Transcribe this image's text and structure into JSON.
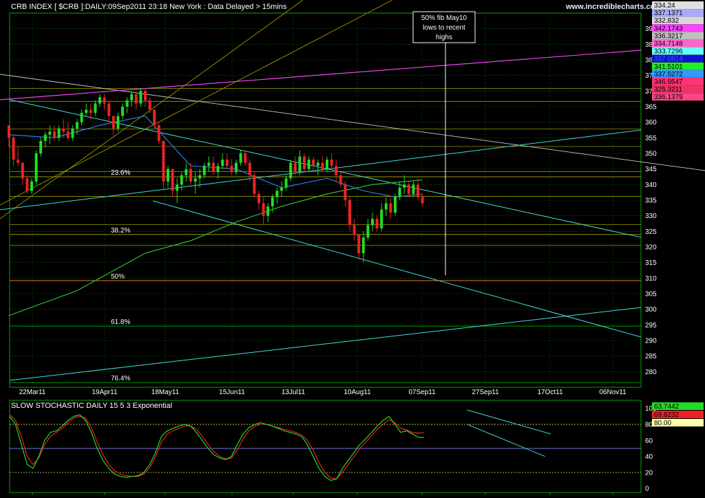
{
  "header": {
    "title": "CRB INDEX [ $CRB ]:DAILY:09Sep2011 23:18 New York  : Data Delayed > 15mins",
    "brand": "www.incrediblecharts.com"
  },
  "colors": {
    "background": "#000000",
    "grid": "#00aa00",
    "up": "#22dd22",
    "down": "#ee2222",
    "ma_short": "#3388ff",
    "ma_long": "#33cc33",
    "fib_line": "#999900",
    "fib_50": "#ff8833",
    "trend_cyan": "#44dddd",
    "trend_magenta": "#ee44ee",
    "trend_white": "#cccccc",
    "trend_olive": "#999900",
    "stoch_k": "#22dd22",
    "stoch_d": "#ee2222"
  },
  "chart_data": [
    {
      "type": "candlestick",
      "title": "CRB INDEX [ $CRB ]:DAILY:09Sep2011 23:18 New York  : Data Delayed > 15mins",
      "x_tick_labels": [
        "22Mar11",
        "19Apr11",
        "18May11",
        "15Jun11",
        "13Jul11",
        "10Aug11",
        "07Sep11",
        "27Sep11",
        "17Oct11",
        "06Nov11"
      ],
      "y_tick_labels": [
        "280",
        "285",
        "290",
        "295",
        "300",
        "305",
        "310",
        "315",
        "320",
        "325",
        "330",
        "335",
        "340",
        "345",
        "350",
        "355",
        "360",
        "365",
        "370",
        "375",
        "380",
        "385",
        "390"
      ],
      "ylim": [
        275,
        395
      ],
      "grid": true,
      "fib_levels": [
        {
          "label": "23.6%",
          "value": 342.5
        },
        {
          "label": "38.2%",
          "value": 324
        },
        {
          "label": "50%",
          "value": 309.2
        },
        {
          "label": "61.8%",
          "value": 294.6
        },
        {
          "label": "76.4%",
          "value": 276.5
        }
      ],
      "extra_levels": [
        370.8,
        366.7,
        357.8,
        352.2,
        344.2,
        336.2,
        327.2,
        320.5
      ],
      "annotation": {
        "lines": [
          "50% fib May10",
          "lows to recent",
          "highs"
        ]
      },
      "value_badges": [
        {
          "label": "334.24",
          "bg": "#e0e0e0",
          "fg": "#000000"
        },
        {
          "label": "337.1371",
          "bg": "#aaaaff",
          "fg": "#000000"
        },
        {
          "label": "332.832",
          "bg": "#d8d8d8",
          "fg": "#000000"
        },
        {
          "label": "342.1743",
          "bg": "#ff44ff",
          "fg": "#000000"
        },
        {
          "label": "336.3217",
          "bg": "#c0c0c0",
          "fg": "#000000"
        },
        {
          "label": "334.7148",
          "bg": "#ff66cc",
          "fg": "#000000"
        },
        {
          "label": "333.7296",
          "bg": "#66ffff",
          "fg": "#000000"
        },
        {
          "label": "337.0814",
          "bg": "#1111cc",
          "fg": "#4455ff"
        },
        {
          "label": "341.5101",
          "bg": "#22ee22",
          "fg": "#000000"
        },
        {
          "label": "337.5272",
          "bg": "#3399ff",
          "fg": "#000000"
        },
        {
          "label": "346.9547",
          "bg": "#ff3377",
          "fg": "#000000"
        },
        {
          "label": "325.3211",
          "bg": "#ee3366",
          "fg": "#000000"
        },
        {
          "label": "336.1379",
          "bg": "#ff4488",
          "fg": "#000000"
        }
      ],
      "candles": [
        [
          0,
          359,
          358,
          352,
          355
        ],
        [
          1,
          355,
          356,
          346,
          348
        ],
        [
          2,
          348,
          352,
          346,
          347
        ],
        [
          3,
          347,
          347,
          340,
          342
        ],
        [
          4,
          342,
          343,
          337,
          338
        ],
        [
          5,
          338,
          342,
          337,
          341
        ],
        [
          6,
          341,
          351,
          340,
          350
        ],
        [
          7,
          350,
          355,
          349,
          354
        ],
        [
          8,
          354,
          357,
          352,
          356
        ],
        [
          9,
          356,
          359,
          353,
          357
        ],
        [
          10,
          357,
          359,
          354,
          355
        ],
        [
          11,
          355,
          359,
          354,
          358
        ],
        [
          12,
          358,
          361,
          355,
          357
        ],
        [
          13,
          357,
          360,
          354,
          355
        ],
        [
          14,
          355,
          359,
          354,
          358
        ],
        [
          15,
          358,
          361,
          356,
          360
        ],
        [
          16,
          360,
          364,
          359,
          363
        ],
        [
          17,
          363,
          366,
          362,
          364
        ],
        [
          18,
          364,
          366,
          361,
          363
        ],
        [
          19,
          363,
          367,
          362,
          366
        ],
        [
          20,
          366,
          369,
          365,
          368
        ],
        [
          21,
          368,
          369,
          364,
          366
        ],
        [
          22,
          366,
          367,
          360,
          362
        ],
        [
          23,
          362,
          362,
          356,
          358
        ],
        [
          24,
          358,
          363,
          357,
          362
        ],
        [
          25,
          362,
          366,
          361,
          365
        ],
        [
          26,
          365,
          368,
          363,
          367
        ],
        [
          27,
          367,
          370,
          365,
          369
        ],
        [
          28,
          369,
          369,
          364,
          366
        ],
        [
          29,
          366,
          371,
          365,
          370
        ],
        [
          30,
          370,
          371,
          365,
          367
        ],
        [
          31,
          367,
          368,
          363,
          364
        ],
        [
          32,
          364,
          364,
          358,
          359
        ],
        [
          33,
          359,
          360,
          353,
          354
        ],
        [
          34,
          354,
          354,
          338,
          341
        ],
        [
          35,
          341,
          346,
          339,
          345
        ],
        [
          36,
          345,
          345,
          336,
          338
        ],
        [
          37,
          338,
          342,
          334,
          340
        ],
        [
          38,
          340,
          344,
          338,
          343
        ],
        [
          39,
          343,
          347,
          341,
          345
        ],
        [
          40,
          345,
          347,
          340,
          341
        ],
        [
          41,
          341,
          344,
          337,
          342
        ],
        [
          42,
          342,
          345,
          339,
          343
        ],
        [
          43,
          343,
          347,
          342,
          346
        ],
        [
          44,
          346,
          349,
          344,
          347
        ],
        [
          45,
          347,
          349,
          343,
          344
        ],
        [
          46,
          344,
          347,
          342,
          346
        ],
        [
          47,
          346,
          350,
          345,
          348
        ],
        [
          48,
          348,
          350,
          345,
          346
        ],
        [
          49,
          346,
          348,
          343,
          344
        ],
        [
          50,
          344,
          348,
          343,
          347
        ],
        [
          51,
          347,
          351,
          346,
          350
        ],
        [
          52,
          350,
          351,
          346,
          347
        ],
        [
          53,
          347,
          348,
          341,
          343
        ],
        [
          54,
          343,
          344,
          336,
          337
        ],
        [
          55,
          337,
          338,
          332,
          334
        ],
        [
          56,
          334,
          336,
          327,
          330
        ],
        [
          57,
          330,
          334,
          328,
          333
        ],
        [
          58,
          333,
          337,
          331,
          336
        ],
        [
          59,
          336,
          339,
          334,
          338
        ],
        [
          60,
          338,
          341,
          336,
          339
        ],
        [
          61,
          339,
          343,
          338,
          342
        ],
        [
          62,
          342,
          348,
          341,
          347
        ],
        [
          63,
          347,
          349,
          343,
          344
        ],
        [
          64,
          344,
          351,
          343,
          349
        ],
        [
          65,
          349,
          350,
          344,
          345
        ],
        [
          66,
          345,
          349,
          344,
          348
        ],
        [
          67,
          348,
          349,
          344,
          346
        ],
        [
          68,
          346,
          348,
          343,
          347
        ],
        [
          69,
          347,
          349,
          344,
          345
        ],
        [
          70,
          345,
          349,
          344,
          348
        ],
        [
          71,
          348,
          350,
          345,
          346
        ],
        [
          72,
          346,
          348,
          341,
          343
        ],
        [
          73,
          343,
          344,
          339,
          340
        ],
        [
          74,
          340,
          341,
          333,
          335
        ],
        [
          75,
          335,
          336,
          325,
          327
        ],
        [
          76,
          327,
          329,
          322,
          324
        ],
        [
          77,
          324,
          324,
          316,
          318
        ],
        [
          78,
          318,
          325,
          315,
          323
        ],
        [
          79,
          323,
          329,
          322,
          327
        ],
        [
          80,
          327,
          331,
          325,
          329
        ],
        [
          81,
          329,
          330,
          325,
          326
        ],
        [
          82,
          326,
          334,
          325,
          332
        ],
        [
          83,
          332,
          336,
          330,
          334
        ],
        [
          84,
          334,
          336,
          329,
          331
        ],
        [
          85,
          331,
          337,
          330,
          336
        ],
        [
          86,
          336,
          341,
          335,
          339
        ],
        [
          87,
          339,
          343,
          337,
          340
        ],
        [
          88,
          340,
          341,
          336,
          337
        ],
        [
          89,
          337,
          341,
          336,
          340
        ],
        [
          90,
          340,
          342,
          335,
          336
        ],
        [
          91,
          336,
          337,
          333,
          334
        ]
      ],
      "ma_short": [
        [
          0,
          356
        ],
        [
          10,
          355
        ],
        [
          20,
          359
        ],
        [
          30,
          362
        ],
        [
          40,
          346
        ],
        [
          50,
          345
        ],
        [
          60,
          339
        ],
        [
          70,
          342
        ],
        [
          78,
          338
        ],
        [
          85,
          336
        ],
        [
          91,
          337
        ]
      ],
      "ma_long": [
        [
          0,
          298
        ],
        [
          15,
          306
        ],
        [
          30,
          318
        ],
        [
          40,
          322
        ],
        [
          50,
          328
        ],
        [
          60,
          333
        ],
        [
          70,
          337
        ],
        [
          80,
          340
        ],
        [
          91,
          341.5
        ]
      ]
    },
    {
      "type": "line",
      "title": "SLOW STOCHASTIC DAILY 15 5 3 Exponential",
      "y_tick_labels": [
        "0",
        "20",
        "40",
        "60",
        "80",
        "100"
      ],
      "ylim": [
        -5,
        110
      ],
      "reference_lines": [
        20,
        50,
        80
      ],
      "value_badges": [
        {
          "label": "63.7442",
          "bg": "#22dd22",
          "fg": "#000000"
        },
        {
          "label": "69.6232",
          "bg": "#ee2222",
          "fg": "#000000"
        },
        {
          "label": "80.00",
          "bg": "#ffffaa",
          "fg": "#000000"
        }
      ],
      "series": [
        {
          "values": [
            90,
            80,
            55,
            30,
            25,
            40,
            60,
            70,
            72,
            78,
            85,
            90,
            92,
            85,
            70,
            50,
            35,
            25,
            18,
            15,
            14,
            15,
            16,
            20,
            30,
            45,
            65,
            72,
            75,
            78,
            80,
            78,
            70,
            60,
            50,
            42,
            38,
            36,
            40,
            55,
            68,
            76,
            80,
            82,
            80,
            78,
            75,
            72,
            70,
            68,
            65,
            55,
            40,
            25,
            15,
            10,
            12,
            25,
            35,
            45,
            55,
            62,
            70,
            78,
            85,
            90,
            80,
            70,
            72,
            68,
            64,
            63.7
          ]
        },
        {
          "values": [
            92,
            85,
            65,
            40,
            30,
            38,
            55,
            65,
            70,
            75,
            82,
            88,
            90,
            88,
            76,
            58,
            42,
            30,
            22,
            18,
            16,
            15,
            15,
            18,
            26,
            40,
            58,
            68,
            72,
            75,
            78,
            78,
            74,
            65,
            55,
            46,
            40,
            37,
            38,
            48,
            62,
            72,
            78,
            80,
            80,
            78,
            76,
            74,
            72,
            70,
            67,
            60,
            48,
            32,
            20,
            13,
            12,
            20,
            30,
            40,
            50,
            58,
            66,
            74,
            80,
            86,
            82,
            75,
            73,
            70,
            69,
            69.6
          ]
        }
      ],
      "trendlines": [
        [
          [
            76,
            98
          ],
          [
            88,
            68
          ]
        ],
        [
          [
            76,
            80
          ],
          [
            87,
            40
          ]
        ]
      ]
    }
  ]
}
